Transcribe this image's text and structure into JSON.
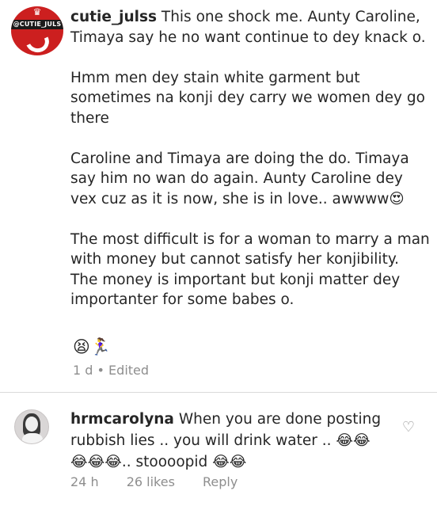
{
  "main_comment": {
    "avatar_logo_text": "@CUTIE_JULS",
    "username": "cutie_julss",
    "paragraphs": [
      "This one shock me. Aunty Caroline, Timaya say he no want continue to dey knack o.",
      "Hmm men dey stain white garment but sometimes na konji dey carry we women dey go there",
      "Caroline and Timaya are doing the do. Timaya say him no wan do again. Aunty Caroline dey vex cuz as it is now, she is in love.. awwww😍",
      "The most difficult is for a woman to marry a man with money but cannot satisfy her konjibility. The money is important but konji matter dey importanter for some babes o."
    ],
    "emojis": "😫🏃‍♀️",
    "time": "1 d",
    "separator": "•",
    "edited": "Edited"
  },
  "reply_comment": {
    "username": "hrmcarolyna",
    "text": "When you are done posting rubbish lies .. you will drink water .. 😂😂😂😂😂.. stoooopid 😂😂",
    "time": "24 h",
    "likes": "26 likes",
    "reply_label": "Reply",
    "like_icon": "heart-outline-icon"
  }
}
